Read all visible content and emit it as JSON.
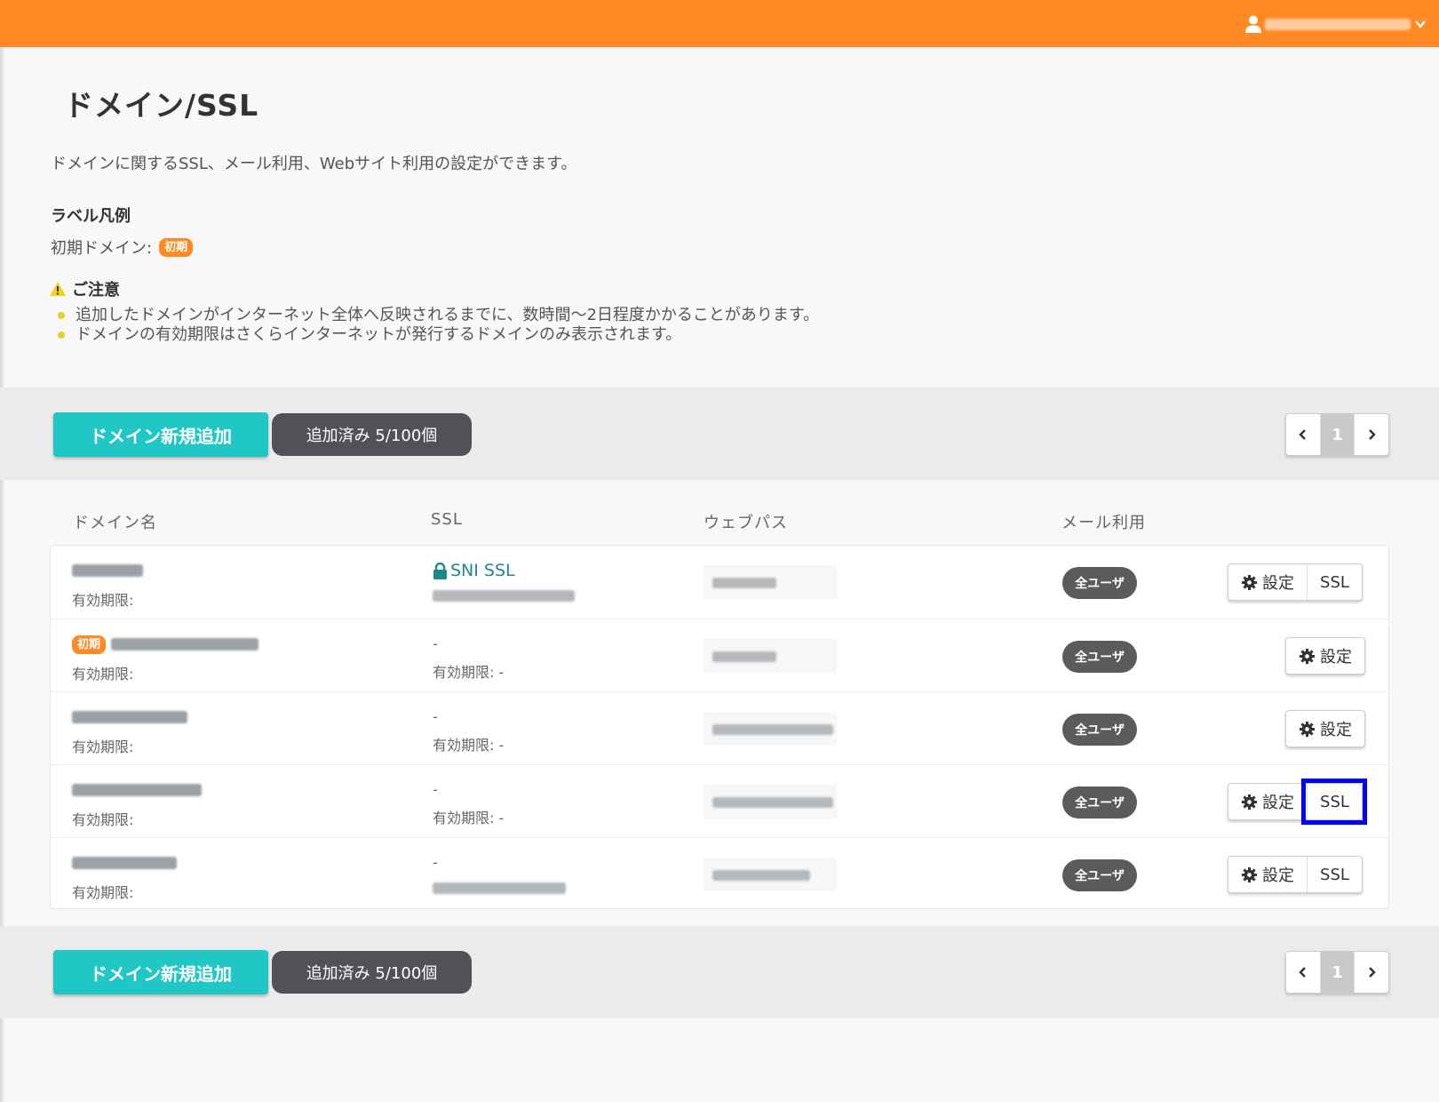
{
  "header": {
    "account_label": ""
  },
  "page": {
    "title": "ドメイン/SSL",
    "description": "ドメインに関するSSL、メール利用、Webサイト利用の設定ができます。",
    "legend_title": "ラベル凡例",
    "legend_initial_label": "初期ドメイン:",
    "initial_badge": "初期",
    "notice_title": "ご注意",
    "notices": [
      "追加したドメインがインターネット全体へ反映されるまでに、数時間〜2日程度かかることがあります。",
      "ドメインの有効期限はさくらインターネットが発行するドメインのみ表示されます。"
    ]
  },
  "toolbar": {
    "add_domain_label": "ドメイン新規追加",
    "count_label": "追加済み 5/100個",
    "current_page": "1"
  },
  "table": {
    "headers": {
      "domain": "ドメイン名",
      "ssl": "SSL",
      "web_path": "ウェブパス",
      "mail": "メール利用"
    },
    "rows": [
      {
        "expiry_label": "有効期限:",
        "ssl_label": "SNI SSL",
        "mail": "全ユーザ",
        "settings": "設定",
        "ssl_button": "SSL"
      },
      {
        "expiry_label": "有効期限:",
        "ssl_label": "-",
        "ssl_expiry": "有効期限: -",
        "mail": "全ユーザ",
        "settings": "設定"
      },
      {
        "expiry_label": "有効期限:",
        "ssl_label": "-",
        "ssl_expiry": "有効期限: -",
        "mail": "全ユーザ",
        "settings": "設定"
      },
      {
        "expiry_label": "有効期限:",
        "ssl_label": "-",
        "ssl_expiry": "有効期限: -",
        "mail": "全ユーザ",
        "settings": "設定",
        "ssl_button": "SSL"
      },
      {
        "expiry_label": "有効期限:",
        "ssl_label": "-",
        "mail": "全ユーザ",
        "settings": "設定",
        "ssl_button": "SSL"
      }
    ]
  },
  "colors": {
    "header": "#ff8a24",
    "primary_button": "#21c7c5",
    "highlight": "#0000ff"
  }
}
